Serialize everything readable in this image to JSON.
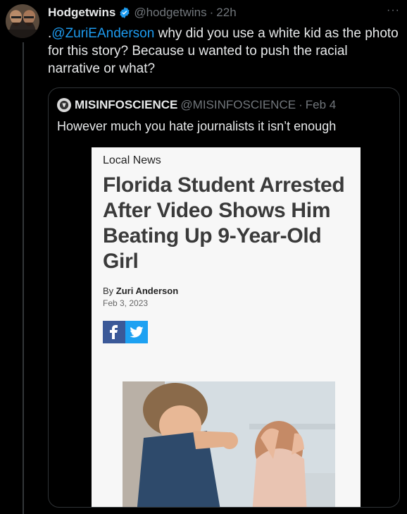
{
  "tweet": {
    "display_name": "Hodgetwins",
    "handle": "@hodgetwins",
    "separator": "·",
    "time": "22h",
    "more_label": "···",
    "text_prefix": ".",
    "mention": "@ZuriEAnderson",
    "text_body": " why did you use a white kid as the photo for this story? Because u wanted to push the racial narrative or what?"
  },
  "quote": {
    "display_name": "MISINFOSCIENCE",
    "handle": "@MISINFOSCIENCE",
    "separator": "·",
    "time": "Feb 4",
    "text": "However much you hate journalists it isn’t enough",
    "article": {
      "section": "Local News",
      "headline": "Florida Student Arrested After Video Shows Him Beating Up 9-Year-Old Girl",
      "byline_prefix": "By ",
      "author": "Zuri Anderson",
      "date": "Feb 3, 2023"
    }
  },
  "colors": {
    "background": "#000000",
    "accent": "#1d9bf0",
    "verified": "#1d9bf0",
    "facebook": "#3b5998",
    "twitter": "#1da1f2"
  },
  "icons": [
    "verified-badge-icon",
    "more-options-icon",
    "facebook-icon",
    "twitter-icon"
  ]
}
